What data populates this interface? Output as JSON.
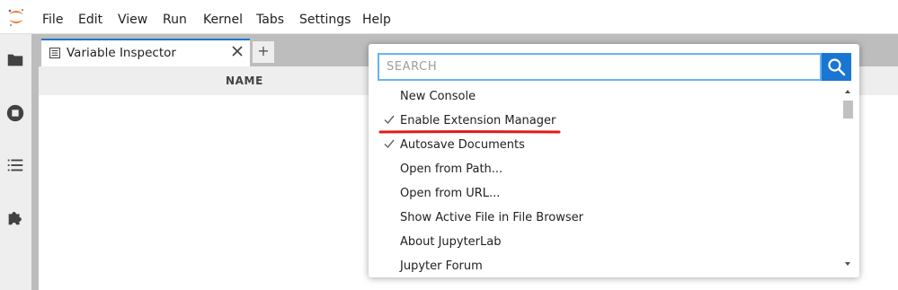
{
  "menubar": {
    "items": [
      "File",
      "Edit",
      "View",
      "Run",
      "Kernel",
      "Tabs",
      "Settings",
      "Help"
    ]
  },
  "sidebar": {
    "icons": [
      "folder-icon",
      "stop-circle-icon",
      "list-icon",
      "puzzle-icon"
    ]
  },
  "tab": {
    "title": "Variable Inspector",
    "add_label": "+"
  },
  "inspector": {
    "column_name": "NAME"
  },
  "palette": {
    "search_placeholder": "SEARCH",
    "items": [
      {
        "label": "New Console",
        "checked": false
      },
      {
        "label": "Enable Extension Manager",
        "checked": true
      },
      {
        "label": "Autosave Documents",
        "checked": true
      },
      {
        "label": "Open from Path...",
        "checked": false
      },
      {
        "label": "Open from URL...",
        "checked": false
      },
      {
        "label": "Show Active File in File Browser",
        "checked": false
      },
      {
        "label": "About JupyterLab",
        "checked": false
      },
      {
        "label": "Jupyter Forum",
        "checked": false
      }
    ]
  },
  "colors": {
    "accent": "#1976d2",
    "search_border": "#64b5f6",
    "annotation_red": "#e01a1a",
    "logo_orange": "#f37726"
  }
}
